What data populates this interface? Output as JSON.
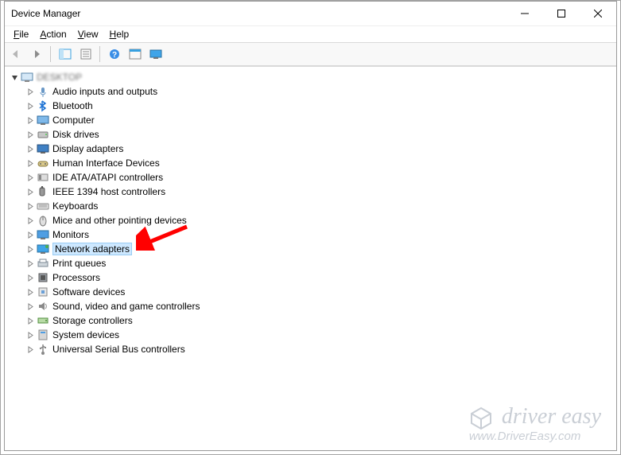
{
  "window": {
    "title": "Device Manager"
  },
  "menu": {
    "file": "File",
    "action": "Action",
    "view": "View",
    "help": "Help"
  },
  "root": {
    "label": "DESKTOP"
  },
  "categories": [
    {
      "key": "audio",
      "label": "Audio inputs and outputs"
    },
    {
      "key": "bluetooth",
      "label": "Bluetooth"
    },
    {
      "key": "computer",
      "label": "Computer"
    },
    {
      "key": "disk",
      "label": "Disk drives"
    },
    {
      "key": "display",
      "label": "Display adapters"
    },
    {
      "key": "hid",
      "label": "Human Interface Devices"
    },
    {
      "key": "ide",
      "label": "IDE ATA/ATAPI controllers"
    },
    {
      "key": "ieee1394",
      "label": "IEEE 1394 host controllers"
    },
    {
      "key": "keyboard",
      "label": "Keyboards"
    },
    {
      "key": "mouse",
      "label": "Mice and other pointing devices"
    },
    {
      "key": "monitor",
      "label": "Monitors"
    },
    {
      "key": "network",
      "label": "Network adapters",
      "selected": true
    },
    {
      "key": "printq",
      "label": "Print queues"
    },
    {
      "key": "cpu",
      "label": "Processors"
    },
    {
      "key": "softdev",
      "label": "Software devices"
    },
    {
      "key": "sound",
      "label": "Sound, video and game controllers"
    },
    {
      "key": "storage",
      "label": "Storage controllers"
    },
    {
      "key": "system",
      "label": "System devices"
    },
    {
      "key": "usb",
      "label": "Universal Serial Bus controllers"
    }
  ],
  "watermark": {
    "brand": "driver easy",
    "url": "www.DriverEasy.com"
  },
  "colors": {
    "selection_bg": "#cde8ff",
    "selection_border": "#99ccf3",
    "arrow": "#ff0000",
    "watermark": "#9ea7b3"
  }
}
